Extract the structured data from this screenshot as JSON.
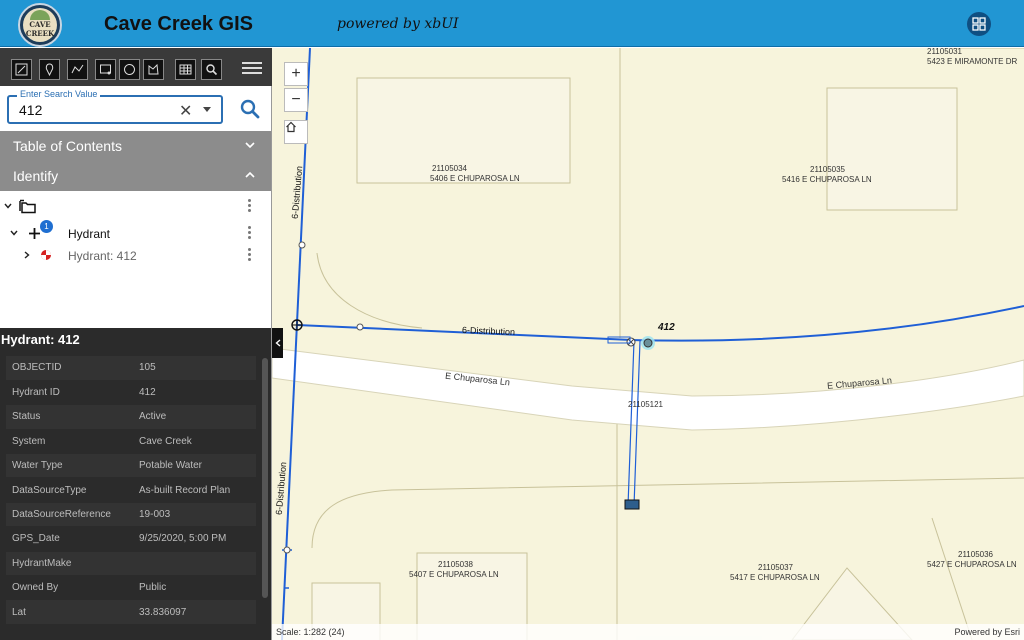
{
  "header": {
    "logo_text": "CAVE CREEK",
    "title": "Cave Creek GIS",
    "tagline": "powered by xbUI",
    "apps_icon": "grid-icon"
  },
  "toolbar": {
    "tools": [
      "draw-icon",
      "pin-icon",
      "polyline-icon",
      "polygon-icon",
      "circle-icon",
      "freehand-icon",
      "table-icon",
      "search-icon"
    ],
    "menu_icon": "hamburger-icon"
  },
  "search": {
    "label": "Enter Search Value",
    "value": "412",
    "clear_icon": "close-icon",
    "dropdown_icon": "chevron-down-icon",
    "button_icon": "search-icon"
  },
  "panels": {
    "toc": "Table of Contents",
    "identify": "Identify"
  },
  "tree": {
    "root_icon": "folder-icon",
    "layer_label": "Hydrant",
    "layer_badge": "1",
    "feature_label": "Hydrant: 412"
  },
  "details": {
    "title": "Hydrant: 412",
    "rows": [
      {
        "key": "OBJECTID",
        "value": "105"
      },
      {
        "key": "Hydrant ID",
        "value": "412"
      },
      {
        "key": "Status",
        "value": "Active"
      },
      {
        "key": "System",
        "value": "Cave Creek"
      },
      {
        "key": "Water Type",
        "value": "Potable Water"
      },
      {
        "key": "DataSourceType",
        "value": "As-built Record Plan"
      },
      {
        "key": "DataSourceReference",
        "value": "19-003"
      },
      {
        "key": "GPS_Date",
        "value": "9/25/2020, 5:00 PM"
      },
      {
        "key": "HydrantMake",
        "value": ""
      },
      {
        "key": "Owned By",
        "value": "Public"
      },
      {
        "key": "Lat",
        "value": "33.836097"
      }
    ]
  },
  "map": {
    "zoom_in": "+",
    "zoom_out": "−",
    "home_icon": "home-icon",
    "labels": {
      "parcel_top_right_id": "21105031",
      "parcel_top_right_addr": "5423 E MIRAMONTE DR",
      "parcel_a_id": "21105034",
      "parcel_a_addr": "5406 E CHUPAROSA LN",
      "parcel_b_id": "21105035",
      "parcel_b_addr": "5416 E CHUPAROSA LN",
      "road_id": "21105121",
      "parcel_c_id": "21105038",
      "parcel_c_addr": "5407 E CHUPAROSA LN",
      "parcel_d_id": "21105037",
      "parcel_d_addr": "5417 E CHUPAROSA LN",
      "parcel_e_id": "21105036",
      "parcel_e_addr": "5427 E CHUPAROSA LN",
      "street_left": "E Chuparosa Ln",
      "street_right": "E Chuparosa Ln",
      "main_label": "6-Distribution",
      "main_label_v1": "6-Distribution",
      "main_label_v2": "6-Distribution",
      "hydrant_label": "412"
    },
    "scale": "Scale: 1:282 (24)",
    "attribution": "Powered by Esri"
  },
  "colors": {
    "header": "#2196d3",
    "water_main": "#1f5fd6",
    "parcel_fill": "#f7f4dc",
    "building": "#f8f5e3",
    "road": "#ffffff"
  }
}
